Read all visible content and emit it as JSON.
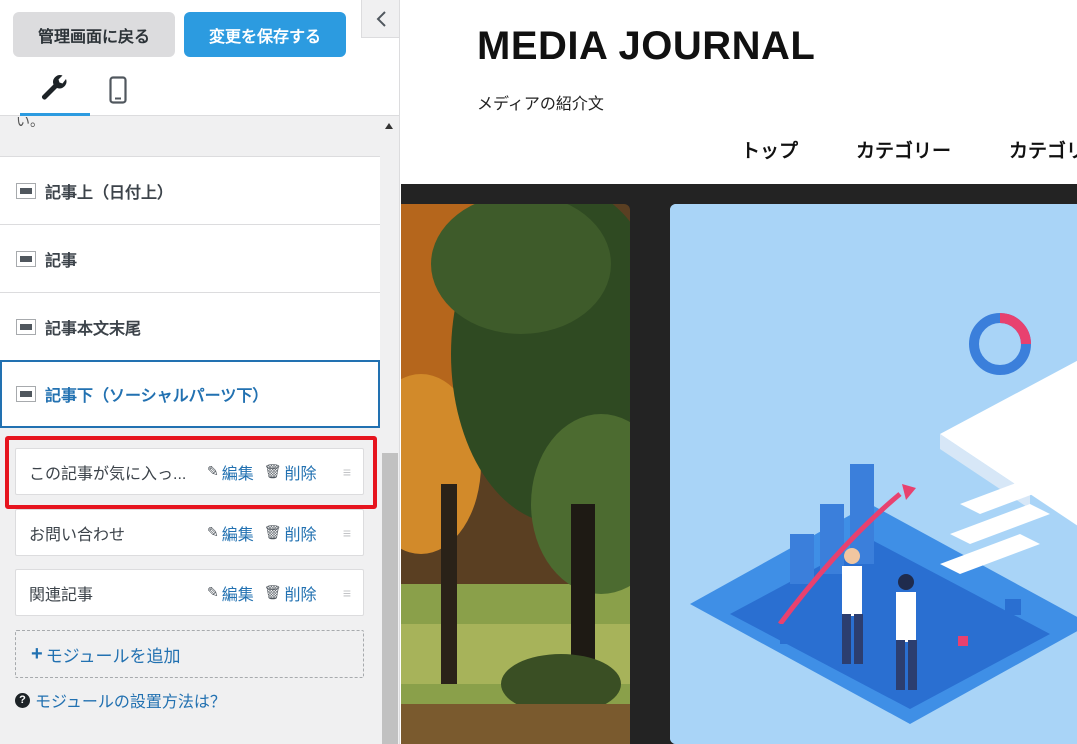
{
  "toolbar": {
    "back_label": "管理画面に戻る",
    "save_label": "変更を保存する"
  },
  "tabs": [
    "wrench-icon",
    "mobile-icon"
  ],
  "cut_text": "い。",
  "sections": [
    {
      "label": "記事上（日付上）"
    },
    {
      "label": "記事"
    },
    {
      "label": "記事本文末尾"
    },
    {
      "label": "記事下（ソーシャルパーツ下）"
    }
  ],
  "modules": [
    {
      "label": "この記事が気に入っ...",
      "edit": "編集",
      "delete": "削除"
    },
    {
      "label": "お問い合わせ",
      "edit": "編集",
      "delete": "削除"
    },
    {
      "label": "関連記事",
      "edit": "編集",
      "delete": "削除"
    }
  ],
  "add_module": "モジュールを追加",
  "help_link": "モジュールの設置方法は？",
  "preview": {
    "site_title": "MEDIA JOURNAL",
    "site_description": "メディアの紹介文",
    "nav": [
      "トップ",
      "カテゴリー",
      "カテゴリー"
    ]
  },
  "colors": {
    "accent": "#2c9be0",
    "link": "#2271b1",
    "highlight": "#e6141e"
  }
}
